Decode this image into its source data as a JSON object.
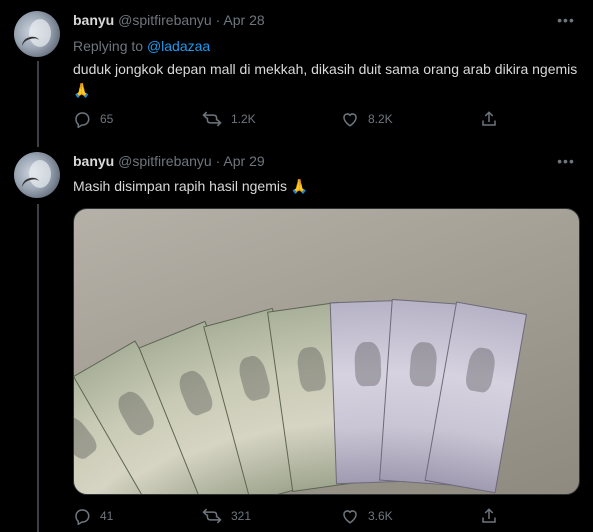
{
  "tweets": [
    {
      "name": "banyu",
      "handle": "@spitfirebanyu",
      "separator": "·",
      "date": "Apr 28",
      "replying_prefix": "Replying to",
      "replying_to": "@ladazaa",
      "text": "duduk jongkok depan mall di mekkah, dikasih duit sama orang arab dikira ngemis 🙏",
      "stats": {
        "replies": "65",
        "retweets": "1.2K",
        "likes": "8.2K"
      }
    },
    {
      "name": "banyu",
      "handle": "@spitfirebanyu",
      "separator": "·",
      "date": "Apr 29",
      "text": "Masih disimpan rapih hasil ngemis 🙏",
      "stats": {
        "replies": "41",
        "retweets": "321",
        "likes": "3.6K"
      }
    }
  ],
  "icons": [
    "reply-icon",
    "retweet-icon",
    "like-icon",
    "share-icon",
    "more-icon"
  ],
  "colors": {
    "background": "#000000",
    "text": "#d9d9d9",
    "muted": "#6e767d",
    "link": "#1d9bf0",
    "divider": "#2f3336"
  }
}
